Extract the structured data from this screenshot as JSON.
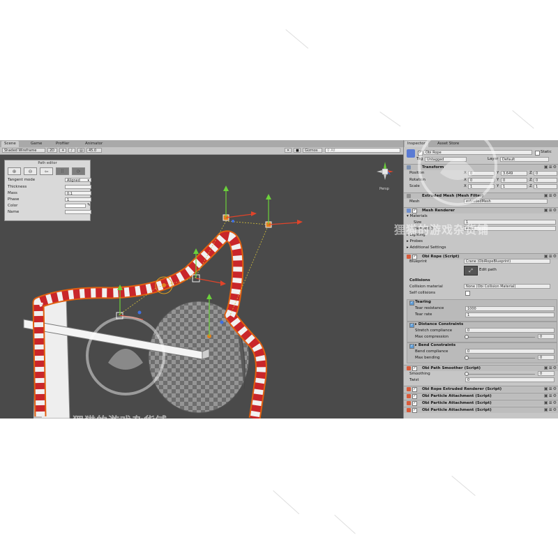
{
  "scene_tabs": [
    "Scene",
    "Game",
    "Profiler",
    "Animator"
  ],
  "scene_toolbar": {
    "shading": "Shaded Wireframe",
    "mode_2d": "2D",
    "fov": "45.0",
    "gizmos": "Gizmos",
    "search_placeholder": "All"
  },
  "path_editor": {
    "title": "Path editor",
    "tangent_mode_label": "Tangent mode",
    "tangent_mode_value": "Aligned",
    "thickness_label": "Thickness",
    "thickness_value": "",
    "mass_label": "Mass",
    "mass_value": "0.1",
    "phase_label": "Phase",
    "phase_value": "1",
    "color_label": "Color",
    "name_label": "Name",
    "name_value": ""
  },
  "scene_gizmo": {
    "label": "Persp"
  },
  "inspector": {
    "tabs": [
      "Inspector",
      "Asset Store"
    ],
    "object_name": "Obi Rope",
    "static_label": "Static",
    "tag_label": "Tag",
    "tag_value": "Untagged",
    "layer_label": "Layer",
    "layer_value": "Default",
    "transform": {
      "title": "Transform",
      "position_label": "Position",
      "rotation_label": "Rotation",
      "scale_label": "Scale",
      "axis_x": "X",
      "axis_y": "Y",
      "axis_z": "Z",
      "position": [
        "0",
        "3.649",
        "0"
      ],
      "rotation": [
        "0",
        "0",
        "0"
      ],
      "scale": [
        "1",
        "1",
        "1"
      ]
    },
    "mesh_filter": {
      "title": "Extruded Mesh (Mesh Filter)",
      "mesh_label": "Mesh",
      "mesh_value": "extrudedMesh"
    },
    "mesh_renderer": {
      "title": "Mesh Renderer",
      "materials_label": "Materials",
      "size_label": "Size",
      "size_value": "1",
      "element_label": "Element 0",
      "element_value": "Rope",
      "lighting_label": "Lighting",
      "probes_label": "Probes",
      "additional_label": "Additional Settings"
    },
    "obi_rope": {
      "title": "Obi Rope (Script)",
      "blueprint_label": "Blueprint",
      "blueprint_value": "Crane (ObiRopeBlueprint)",
      "edit_path_label": "Edit path",
      "collisions_label": "Collisions",
      "collision_material_label": "Collision material",
      "collision_material_value": "None (Obi Collision Material)",
      "self_collisions_label": "Self collisions",
      "tearing_label": "Tearing",
      "tear_resistance_label": "Tear resistance",
      "tear_resistance_value": "1000",
      "tear_rate_label": "Tear rate",
      "tear_rate_value": "1",
      "distance_label": "Distance Constraints",
      "stretch_label": "Stretch compliance",
      "stretch_value": "0",
      "max_compression_label": "Max compression",
      "max_compression_value": "0",
      "bend_label": "Bend Constraints",
      "bend_compliance_label": "Bend compliance",
      "bend_compliance_value": "0",
      "max_bending_label": "Max bending",
      "max_bending_value": "0"
    },
    "smoother": {
      "title": "Obi Path Smoother (Script)",
      "smoothing_label": "Smoothing",
      "smoothing_value": "0",
      "twist_label": "Twist",
      "twist_value": "0"
    },
    "components": [
      "Obi Rope Extruded Renderer (Script)",
      "Obi Particle Attachment (Script)",
      "Obi Particle Attachment (Script)",
      "Obi Particle Attachment (Script)"
    ]
  },
  "watermark": {
    "text": "狸猫的游戏杂货铺"
  }
}
